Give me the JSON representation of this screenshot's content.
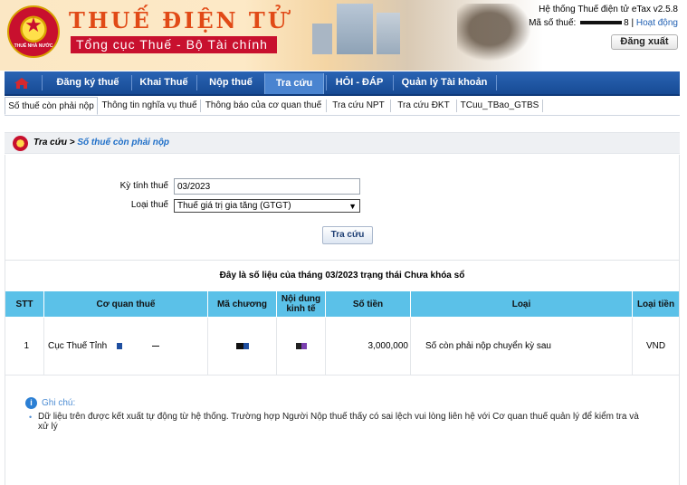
{
  "header": {
    "site_title": "THUẾ ĐIỆN TỬ",
    "site_subtitle": "Tổng cục Thuế - Bộ Tài chính",
    "emblem_text": "THUẾ NHÀ NƯỚC",
    "system_version": "Hệ thống Thuế điện tử eTax v2.5.8",
    "taxcode_label": "Mã số thuế:",
    "taxcode_suffix": "8",
    "help_link": "Hoạt động",
    "logout_label": "Đăng xuất"
  },
  "main_nav": {
    "items": [
      {
        "label": "Đăng ký thuế"
      },
      {
        "label": "Khai Thuế"
      },
      {
        "label": "Nộp thuế"
      },
      {
        "label": "Tra cứu"
      },
      {
        "label": "HỎI - ĐÁP"
      },
      {
        "label": "Quản lý Tài khoản"
      }
    ],
    "active_index": 3
  },
  "sub_nav": {
    "items": [
      {
        "label": "Số thuế còn phải nộp"
      },
      {
        "label": "Thông tin nghĩa vụ thuế"
      },
      {
        "label": "Thông báo của cơ quan thuế"
      },
      {
        "label": "Tra cứu NPT"
      },
      {
        "label": "Tra cứu ĐKT"
      },
      {
        "label": "TCuu_TBao_GTBS"
      }
    ],
    "active_index": 0
  },
  "breadcrumb": {
    "root": "Tra cứu",
    "separator": " > ",
    "current": "Số thuế còn phải nộp"
  },
  "form": {
    "period_label": "Kỳ tính thuế",
    "period_value": "03/2023",
    "tax_type_label": "Loại thuế",
    "tax_type_value": "Thuế giá trị gia tăng (GTGT)",
    "search_button": "Tra cứu"
  },
  "result_caption": "Đây là số liệu của tháng 03/2023 trạng thái Chưa khóa sổ",
  "table": {
    "headers": [
      "STT",
      "Cơ quan thuế",
      "Mã chương",
      "Nội dung kinh tế",
      "Số tiền",
      "Loại",
      "Loại tiền"
    ],
    "rows": [
      {
        "stt": "1",
        "agency": "Cục Thuế Tỉnh",
        "chapter": "",
        "economic_content": "",
        "amount": "3,000,000",
        "type": "Số còn phải nộp chuyển kỳ sau",
        "currency": "VND"
      }
    ]
  },
  "note": {
    "title": "Ghi chú:",
    "text": "Dữ liệu trên được kết xuất tự động từ hệ thống. Trường hợp Người Nộp thuế thấy có sai lệch vui lòng liên hệ với Cơ quan thuế quản lý để kiểm tra và xử lý"
  },
  "colors": {
    "nav_blue": "#1f56a3",
    "table_header": "#5bc1e8",
    "title_orange": "#e14a17",
    "subtitle_red": "#c8102e"
  }
}
